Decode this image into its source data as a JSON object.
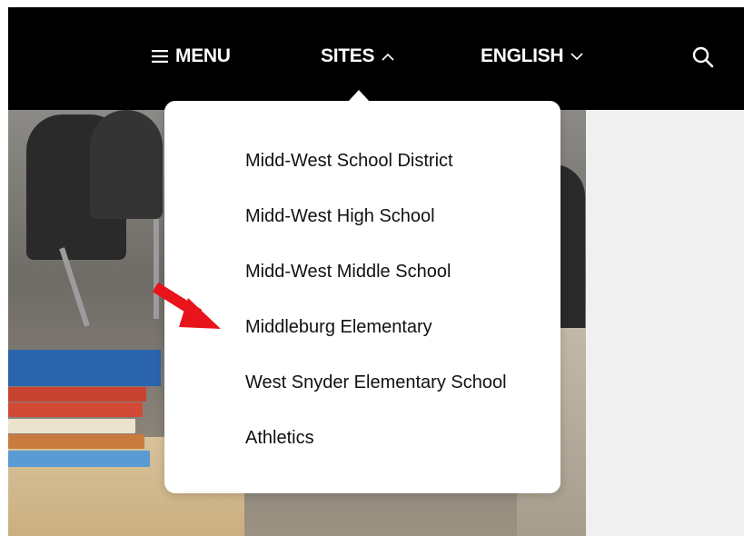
{
  "nav": {
    "menu_label": "MENU",
    "sites_label": "SITES",
    "language_label": "ENGLISH",
    "search_icon": "search-icon"
  },
  "sites_dropdown": {
    "items": [
      {
        "label": "Midd-West School District"
      },
      {
        "label": "Midd-West High School"
      },
      {
        "label": "Midd-West Middle School"
      },
      {
        "label": "Middleburg Elementary"
      },
      {
        "label": "West Snyder Elementary School"
      },
      {
        "label": "Athletics"
      }
    ],
    "annotation": {
      "icon": "red-arrow-icon",
      "color": "#e8131b"
    }
  },
  "colors": {
    "topbar": "#000000",
    "dropdown_bg": "#ffffff",
    "page_bg": "#f0f0f0"
  }
}
